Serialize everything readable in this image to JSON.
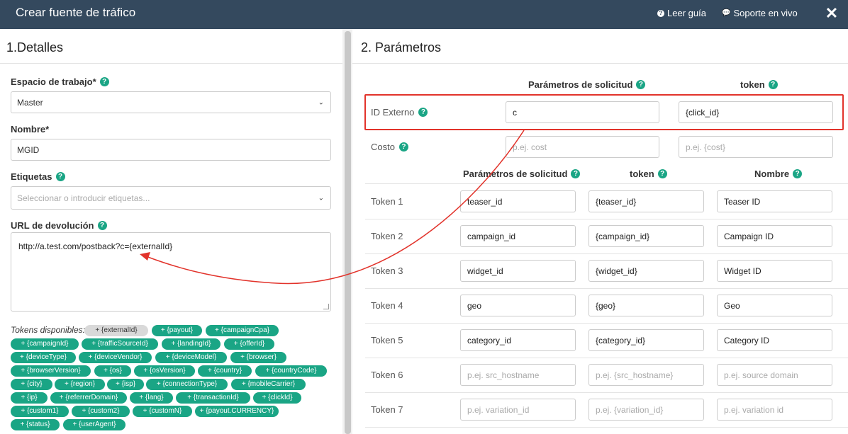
{
  "header": {
    "title": "Crear fuente de tráfico",
    "guide_label": "Leer guía",
    "support_label": "Soporte en vivo",
    "close_label": "✕"
  },
  "details": {
    "section_title": "1.Detalles",
    "workspace_label": "Espacio de trabajo*",
    "workspace_value": "Master",
    "name_label": "Nombre*",
    "name_value": "MGID",
    "tags_label": "Etiquetas",
    "tags_placeholder": "Seleccionar o introducir etiquetas...",
    "postback_label": "URL de devolución",
    "postback_value": "http://a.test.com/postback?c={externalId}",
    "tokens_label": "Tokens disponibles:",
    "tokens": [
      "+ {externalId}",
      "+ {payout}",
      "+ {campaignCpa}",
      "+ {campaignId}",
      "+ {trafficSourceId}",
      "+ {landingId}",
      "+ {offerId}",
      "+ {deviceType}",
      "+ {deviceVendor}",
      "+ {deviceModel}",
      "+ {browser}",
      "+ {browserVersion}",
      "+ {os}",
      "+ {osVersion}",
      "+ {country}",
      "+ {countryCode}",
      "+ {city}",
      "+ {region}",
      "+ {isp}",
      "+ {connectionType}",
      "+ {mobileCarrier}",
      "+ {ip}",
      "+ {referrerDomain}",
      "+ {lang}",
      "+ {transactionId}",
      "+ {clickId}",
      "+ {custom1}",
      "+ {custom2}",
      "+ {customN}",
      "+ {payout.CURRENCY}",
      "+ {status}",
      "+ {userAgent}"
    ]
  },
  "params": {
    "section_title": "2. Parámetros",
    "col_request": "Parámetros de solicitud",
    "col_token": "token",
    "col_name": "Nombre",
    "external_label": "ID Externo",
    "external_param": "c",
    "external_token": "{click_id}",
    "cost_label": "Costo",
    "cost_param_ph": "p.ej. cost",
    "cost_token_ph": "p.ej. {cost}",
    "rows": [
      {
        "label": "Token 1",
        "param": "teaser_id",
        "token": "{teaser_id}",
        "name": "Teaser ID"
      },
      {
        "label": "Token 2",
        "param": "campaign_id",
        "token": "{campaign_id}",
        "name": "Campaign ID"
      },
      {
        "label": "Token 3",
        "param": "widget_id",
        "token": "{widget_id}",
        "name": "Widget ID"
      },
      {
        "label": "Token 4",
        "param": "geo",
        "token": "{geo}",
        "name": "Geo"
      },
      {
        "label": "Token 5",
        "param": "category_id",
        "token": "{category_id}",
        "name": "Category ID"
      },
      {
        "label": "Token 6",
        "param": "p.ej. src_hostname",
        "token": "p.ej.  {src_hostname}",
        "name": "p.ej. source domain"
      },
      {
        "label": "Token 7",
        "param": "p.ej. variation_id",
        "token": "p.ej. {variation_id}",
        "name": "p.ej. variation id"
      }
    ]
  },
  "colors": {
    "header_bg": "#34495e",
    "accent": "#1aa585",
    "highlight": "#e2332b"
  }
}
